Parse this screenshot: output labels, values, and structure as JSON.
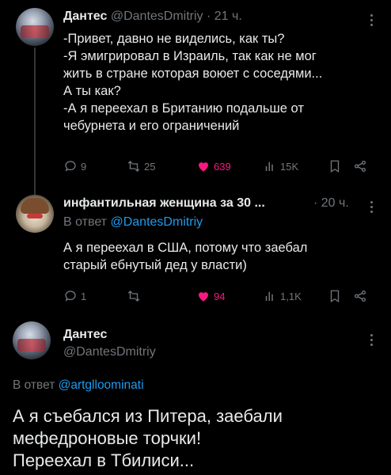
{
  "tweet1": {
    "name": "Дантес",
    "handle": "@DantesDmitriy",
    "sep": "·",
    "time": "21 ч.",
    "lines": [
      "-Привет, давно не виделись, как ты?",
      "-Я эмигрировал в Израиль, так как не мог",
      "жить в стране которая воюет с соседями...",
      "А ты как?",
      "-А я переехал в Британию подальше от",
      "чебурнета и его ограничений"
    ],
    "actions": {
      "replies": "9",
      "retweets": "25",
      "likes": "639",
      "views": "15K"
    }
  },
  "tweet2": {
    "name": "инфантильная женщина за 30 ...",
    "sep": "·",
    "time": "20 ч.",
    "reply_prefix": "В ответ",
    "reply_to": "@DantesDmitriy",
    "lines": [
      "А я переехал в США, потому что заебал",
      "старый ебнутый дед у власти)"
    ],
    "actions": {
      "replies": "1",
      "retweets": "",
      "likes": "94",
      "views": "1,1K"
    }
  },
  "tweet3": {
    "name": "Дантес",
    "handle": "@DantesDmitriy",
    "reply_prefix": "В ответ",
    "reply_to": "@artglloominati",
    "lines": [
      "А я съебался из Питера, заебали",
      "мефедроновые торчки!",
      "Переехал в Тбилиси..."
    ]
  },
  "colors": {
    "accent": "#1d9bf0",
    "like": "#f91880",
    "muted": "#71767b",
    "background": "#000000"
  },
  "icons": [
    "reply-icon",
    "retweet-icon",
    "heart-icon",
    "views-icon",
    "bookmark-icon",
    "share-icon",
    "more-icon"
  ]
}
